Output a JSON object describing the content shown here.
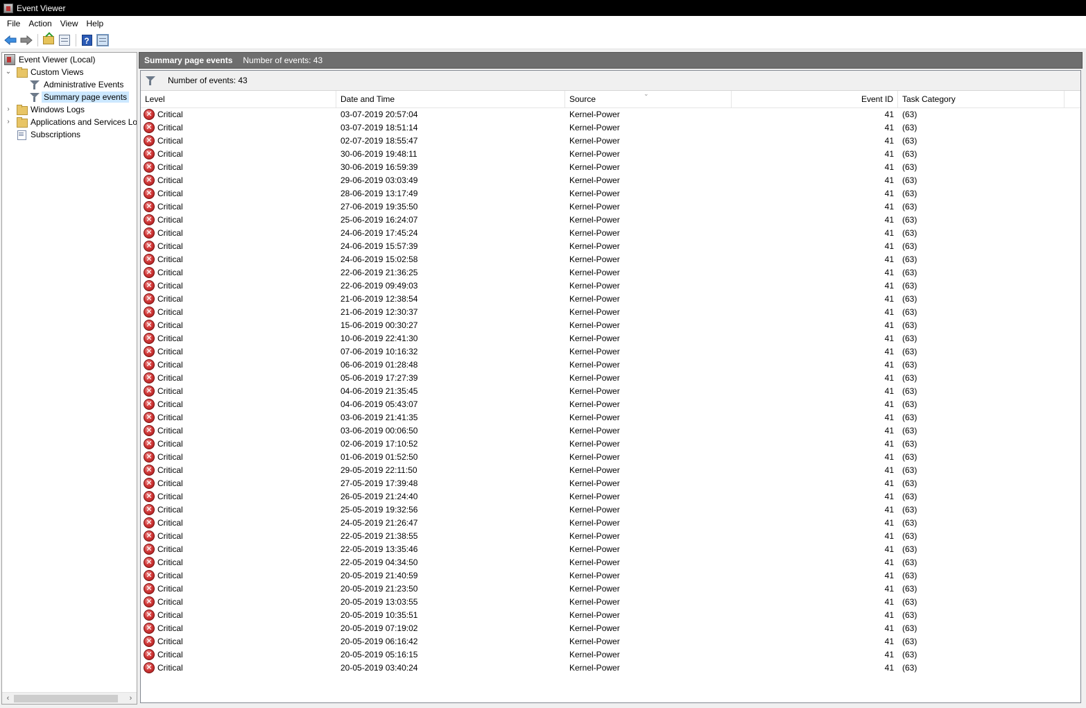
{
  "window": {
    "title": "Event Viewer"
  },
  "menu": [
    "File",
    "Action",
    "View",
    "Help"
  ],
  "toolbar": {
    "icons": [
      "back-arrow-icon",
      "forward-arrow-icon",
      "open-folder-icon",
      "console-tree-icon",
      "help-icon",
      "action-pane-icon"
    ]
  },
  "tree": {
    "root": "Event Viewer (Local)",
    "custom_views": "Custom Views",
    "administrative_events": "Administrative Events",
    "summary_page_events": "Summary page events",
    "windows_logs": "Windows Logs",
    "applications_services": "Applications and Services Lo",
    "subscriptions": "Subscriptions"
  },
  "header": {
    "title": "Summary page events",
    "count": "Number of events: 43"
  },
  "filterbar": {
    "text": "Number of events: 43"
  },
  "columns": {
    "level": "Level",
    "datetime": "Date and Time",
    "source": "Source",
    "event_id": "Event ID",
    "task_category": "Task Category"
  },
  "events": [
    {
      "level": "Critical",
      "datetime": "03-07-2019 20:57:04",
      "source": "Kernel-Power",
      "event_id": "41",
      "task": "(63)"
    },
    {
      "level": "Critical",
      "datetime": "03-07-2019 18:51:14",
      "source": "Kernel-Power",
      "event_id": "41",
      "task": "(63)"
    },
    {
      "level": "Critical",
      "datetime": "02-07-2019 18:55:47",
      "source": "Kernel-Power",
      "event_id": "41",
      "task": "(63)"
    },
    {
      "level": "Critical",
      "datetime": "30-06-2019 19:48:11",
      "source": "Kernel-Power",
      "event_id": "41",
      "task": "(63)"
    },
    {
      "level": "Critical",
      "datetime": "30-06-2019 16:59:39",
      "source": "Kernel-Power",
      "event_id": "41",
      "task": "(63)"
    },
    {
      "level": "Critical",
      "datetime": "29-06-2019 03:03:49",
      "source": "Kernel-Power",
      "event_id": "41",
      "task": "(63)"
    },
    {
      "level": "Critical",
      "datetime": "28-06-2019 13:17:49",
      "source": "Kernel-Power",
      "event_id": "41",
      "task": "(63)"
    },
    {
      "level": "Critical",
      "datetime": "27-06-2019 19:35:50",
      "source": "Kernel-Power",
      "event_id": "41",
      "task": "(63)"
    },
    {
      "level": "Critical",
      "datetime": "25-06-2019 16:24:07",
      "source": "Kernel-Power",
      "event_id": "41",
      "task": "(63)"
    },
    {
      "level": "Critical",
      "datetime": "24-06-2019 17:45:24",
      "source": "Kernel-Power",
      "event_id": "41",
      "task": "(63)"
    },
    {
      "level": "Critical",
      "datetime": "24-06-2019 15:57:39",
      "source": "Kernel-Power",
      "event_id": "41",
      "task": "(63)"
    },
    {
      "level": "Critical",
      "datetime": "24-06-2019 15:02:58",
      "source": "Kernel-Power",
      "event_id": "41",
      "task": "(63)"
    },
    {
      "level": "Critical",
      "datetime": "22-06-2019 21:36:25",
      "source": "Kernel-Power",
      "event_id": "41",
      "task": "(63)"
    },
    {
      "level": "Critical",
      "datetime": "22-06-2019 09:49:03",
      "source": "Kernel-Power",
      "event_id": "41",
      "task": "(63)"
    },
    {
      "level": "Critical",
      "datetime": "21-06-2019 12:38:54",
      "source": "Kernel-Power",
      "event_id": "41",
      "task": "(63)"
    },
    {
      "level": "Critical",
      "datetime": "21-06-2019 12:30:37",
      "source": "Kernel-Power",
      "event_id": "41",
      "task": "(63)"
    },
    {
      "level": "Critical",
      "datetime": "15-06-2019 00:30:27",
      "source": "Kernel-Power",
      "event_id": "41",
      "task": "(63)"
    },
    {
      "level": "Critical",
      "datetime": "10-06-2019 22:41:30",
      "source": "Kernel-Power",
      "event_id": "41",
      "task": "(63)"
    },
    {
      "level": "Critical",
      "datetime": "07-06-2019 10:16:32",
      "source": "Kernel-Power",
      "event_id": "41",
      "task": "(63)"
    },
    {
      "level": "Critical",
      "datetime": "06-06-2019 01:28:48",
      "source": "Kernel-Power",
      "event_id": "41",
      "task": "(63)"
    },
    {
      "level": "Critical",
      "datetime": "05-06-2019 17:27:39",
      "source": "Kernel-Power",
      "event_id": "41",
      "task": "(63)"
    },
    {
      "level": "Critical",
      "datetime": "04-06-2019 21:35:45",
      "source": "Kernel-Power",
      "event_id": "41",
      "task": "(63)"
    },
    {
      "level": "Critical",
      "datetime": "04-06-2019 05:43:07",
      "source": "Kernel-Power",
      "event_id": "41",
      "task": "(63)"
    },
    {
      "level": "Critical",
      "datetime": "03-06-2019 21:41:35",
      "source": "Kernel-Power",
      "event_id": "41",
      "task": "(63)"
    },
    {
      "level": "Critical",
      "datetime": "03-06-2019 00:06:50",
      "source": "Kernel-Power",
      "event_id": "41",
      "task": "(63)"
    },
    {
      "level": "Critical",
      "datetime": "02-06-2019 17:10:52",
      "source": "Kernel-Power",
      "event_id": "41",
      "task": "(63)"
    },
    {
      "level": "Critical",
      "datetime": "01-06-2019 01:52:50",
      "source": "Kernel-Power",
      "event_id": "41",
      "task": "(63)"
    },
    {
      "level": "Critical",
      "datetime": "29-05-2019 22:11:50",
      "source": "Kernel-Power",
      "event_id": "41",
      "task": "(63)"
    },
    {
      "level": "Critical",
      "datetime": "27-05-2019 17:39:48",
      "source": "Kernel-Power",
      "event_id": "41",
      "task": "(63)"
    },
    {
      "level": "Critical",
      "datetime": "26-05-2019 21:24:40",
      "source": "Kernel-Power",
      "event_id": "41",
      "task": "(63)"
    },
    {
      "level": "Critical",
      "datetime": "25-05-2019 19:32:56",
      "source": "Kernel-Power",
      "event_id": "41",
      "task": "(63)"
    },
    {
      "level": "Critical",
      "datetime": "24-05-2019 21:26:47",
      "source": "Kernel-Power",
      "event_id": "41",
      "task": "(63)"
    },
    {
      "level": "Critical",
      "datetime": "22-05-2019 21:38:55",
      "source": "Kernel-Power",
      "event_id": "41",
      "task": "(63)"
    },
    {
      "level": "Critical",
      "datetime": "22-05-2019 13:35:46",
      "source": "Kernel-Power",
      "event_id": "41",
      "task": "(63)"
    },
    {
      "level": "Critical",
      "datetime": "22-05-2019 04:34:50",
      "source": "Kernel-Power",
      "event_id": "41",
      "task": "(63)"
    },
    {
      "level": "Critical",
      "datetime": "20-05-2019 21:40:59",
      "source": "Kernel-Power",
      "event_id": "41",
      "task": "(63)"
    },
    {
      "level": "Critical",
      "datetime": "20-05-2019 21:23:50",
      "source": "Kernel-Power",
      "event_id": "41",
      "task": "(63)"
    },
    {
      "level": "Critical",
      "datetime": "20-05-2019 13:03:55",
      "source": "Kernel-Power",
      "event_id": "41",
      "task": "(63)"
    },
    {
      "level": "Critical",
      "datetime": "20-05-2019 10:35:51",
      "source": "Kernel-Power",
      "event_id": "41",
      "task": "(63)"
    },
    {
      "level": "Critical",
      "datetime": "20-05-2019 07:19:02",
      "source": "Kernel-Power",
      "event_id": "41",
      "task": "(63)"
    },
    {
      "level": "Critical",
      "datetime": "20-05-2019 06:16:42",
      "source": "Kernel-Power",
      "event_id": "41",
      "task": "(63)"
    },
    {
      "level": "Critical",
      "datetime": "20-05-2019 05:16:15",
      "source": "Kernel-Power",
      "event_id": "41",
      "task": "(63)"
    },
    {
      "level": "Critical",
      "datetime": "20-05-2019 03:40:24",
      "source": "Kernel-Power",
      "event_id": "41",
      "task": "(63)"
    }
  ]
}
